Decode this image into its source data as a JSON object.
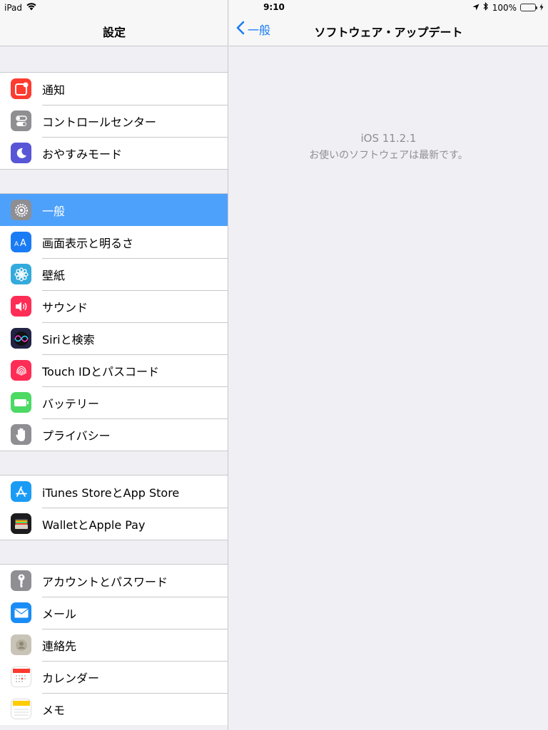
{
  "status_bar": {
    "device": "iPad",
    "time": "9:10",
    "battery": "100%"
  },
  "left": {
    "title": "設定",
    "groups": [
      [
        {
          "label": "通知",
          "icon": "notifications-icon",
          "color": "#fd3b30"
        },
        {
          "label": "コントロールセンター",
          "icon": "control-center-icon",
          "color": "#8e8e93"
        },
        {
          "label": "おやすみモード",
          "icon": "moon-icon",
          "color": "#5856d6"
        }
      ],
      [
        {
          "label": "一般",
          "icon": "gear-icon",
          "color": "#8e8e93"
        },
        {
          "label": "画面表示と明るさ",
          "icon": "display-icon",
          "color": "#1a7cf5"
        },
        {
          "label": "壁紙",
          "icon": "wallpaper-icon",
          "color": "#34aadc"
        },
        {
          "label": "サウンド",
          "icon": "sound-icon",
          "color": "#ff2d55"
        },
        {
          "label": "Siriと検索",
          "icon": "siri-icon",
          "color": "#222244"
        },
        {
          "label": "Touch IDとパスコード",
          "icon": "fingerprint-icon",
          "color": "#ff2d55"
        },
        {
          "label": "バッテリー",
          "icon": "battery-icon",
          "color": "#4cd964"
        },
        {
          "label": "プライバシー",
          "icon": "hand-icon",
          "color": "#8e8e93"
        }
      ],
      [
        {
          "label": "iTunes StoreとApp Store",
          "icon": "app-store-icon",
          "color": "#1a9cf5"
        },
        {
          "label": "WalletとApple Pay",
          "icon": "wallet-icon",
          "color": "#1c1c1e"
        }
      ],
      [
        {
          "label": "アカウントとパスワード",
          "icon": "key-icon",
          "color": "#8e8e93"
        },
        {
          "label": "メール",
          "icon": "mail-icon",
          "color": "#1a8cf5"
        },
        {
          "label": "連絡先",
          "icon": "contacts-icon",
          "color": "#c9c4b8"
        },
        {
          "label": "カレンダー",
          "icon": "calendar-icon",
          "color": "#ffffff"
        },
        {
          "label": "メモ",
          "icon": "notes-icon",
          "color": "#ffffff"
        }
      ]
    ],
    "selected": "一般"
  },
  "right": {
    "back_label": "一般",
    "title": "ソフトウェア・アップデート",
    "version": "iOS 11.2.1",
    "message": "お使いのソフトウェアは最新です。"
  },
  "colors": {
    "accent": "#1a7cf5",
    "selected_row": "#4ea1fb"
  }
}
